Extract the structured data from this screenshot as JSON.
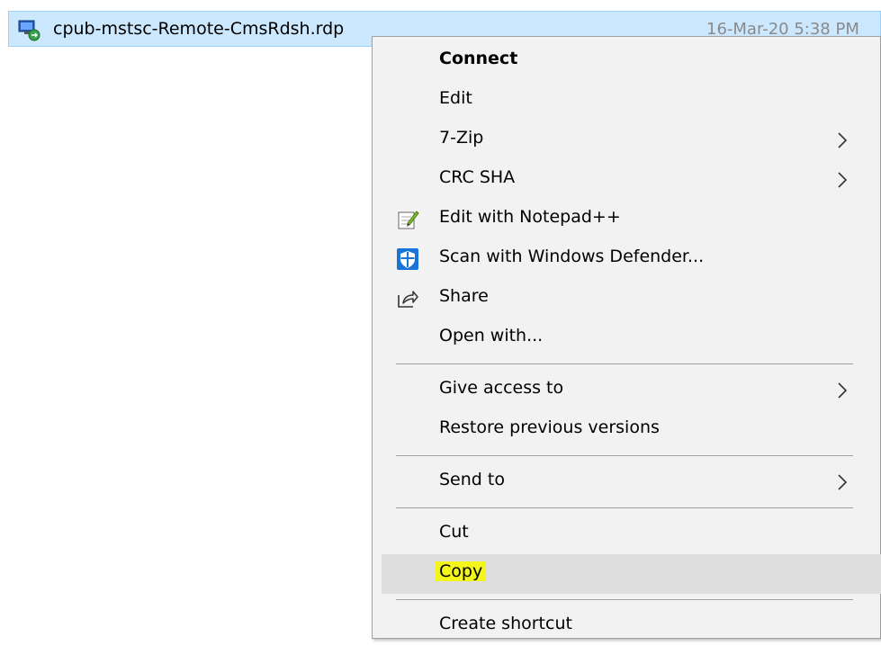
{
  "file": {
    "name": "cpub-mstsc-Remote-CmsRdsh.rdp",
    "date": "16-Mar-20 5:38 PM",
    "icon": "rdp-file-icon"
  },
  "menu": {
    "items": [
      {
        "label": "Connect",
        "bold": true
      },
      {
        "label": "Edit"
      },
      {
        "label": "7-Zip",
        "submenu": true
      },
      {
        "label": "CRC SHA",
        "submenu": true
      },
      {
        "label": "Edit with Notepad++",
        "icon": "notepad-plus-plus-icon"
      },
      {
        "label": "Scan with Windows Defender...",
        "icon": "windows-defender-icon"
      },
      {
        "label": "Share",
        "icon": "share-icon"
      },
      {
        "label": "Open with..."
      },
      {
        "label": "Give access to",
        "submenu": true
      },
      {
        "label": "Restore previous versions"
      },
      {
        "label": "Send to",
        "submenu": true
      },
      {
        "label": "Cut"
      },
      {
        "label": "Copy",
        "hovered": true,
        "highlighted": true
      },
      {
        "label": "Create shortcut"
      }
    ]
  },
  "colors": {
    "selection": "#cce8ff",
    "menu_bg": "#f2f2f2",
    "hover": "#dedede",
    "highlight": "#f4f51a"
  }
}
